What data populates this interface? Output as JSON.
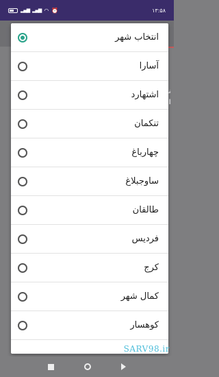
{
  "status_bar": {
    "time": "۱۳:۵۸",
    "icons": [
      "battery-icon",
      "signal-icon",
      "signal-icon",
      "wifi-icon",
      "alarm-icon"
    ]
  },
  "dialog": {
    "options": [
      {
        "label": "انتخاب شهر",
        "selected": true
      },
      {
        "label": "آسارا",
        "selected": false
      },
      {
        "label": "اشتهارد",
        "selected": false
      },
      {
        "label": "تنکمان",
        "selected": false
      },
      {
        "label": "چهارباغ",
        "selected": false
      },
      {
        "label": "ساوجبلاغ",
        "selected": false
      },
      {
        "label": "طالقان",
        "selected": false
      },
      {
        "label": "فردیس",
        "selected": false
      },
      {
        "label": "کرج",
        "selected": false
      },
      {
        "label": "کمال شهر",
        "selected": false
      },
      {
        "label": "کوهسار",
        "selected": false
      }
    ]
  },
  "background": {
    "line1": "نت",
    "line2": "اه"
  },
  "watermark": "SARV98.ir",
  "colors": {
    "status_bar": "#3a2c6a",
    "accent": "#2aa38a",
    "scrim": "#7e7e80"
  }
}
